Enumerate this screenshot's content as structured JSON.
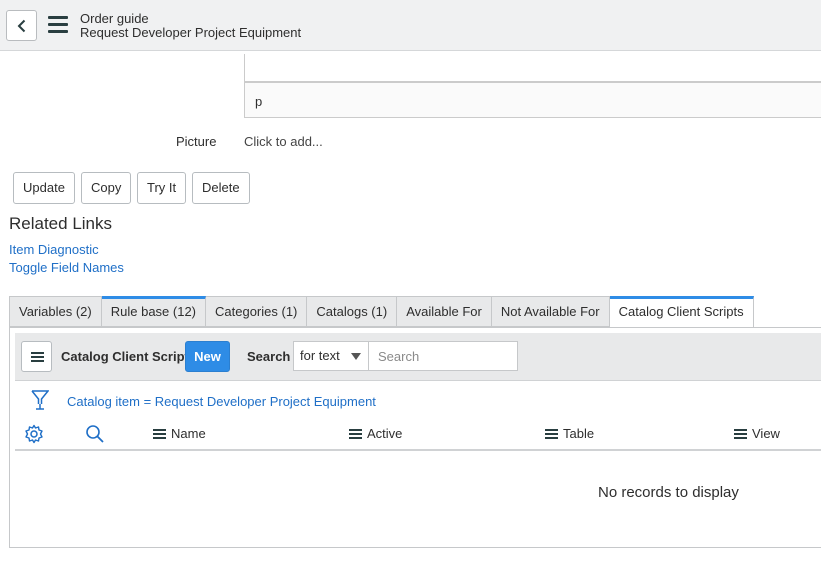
{
  "header": {
    "title": "Order guide",
    "subtitle": "Request Developer Project Equipment"
  },
  "form": {
    "field_value": "p",
    "picture_label": "Picture",
    "picture_value": "Click to add..."
  },
  "actions": {
    "update": "Update",
    "copy": "Copy",
    "try_it": "Try It",
    "delete": "Delete"
  },
  "related_links": {
    "title": "Related Links",
    "items": [
      "Item Diagnostic",
      "Toggle Field Names"
    ]
  },
  "tabs": [
    {
      "label": "Variables (2)"
    },
    {
      "label": "Rule base (12)"
    },
    {
      "label": "Categories (1)"
    },
    {
      "label": "Catalogs (1)"
    },
    {
      "label": "Available For"
    },
    {
      "label": "Not Available For"
    },
    {
      "label": "Catalog Client Scripts"
    }
  ],
  "list": {
    "title": "Catalog Client Scripts",
    "new_label": "New",
    "search_label": "Search",
    "search_field": "for text",
    "search_placeholder": "Search",
    "filter": "Catalog item = Request Developer Project Equipment",
    "columns": [
      "Name",
      "Active",
      "Table",
      "View"
    ],
    "empty_message": "No records to display"
  },
  "colors": {
    "accent": "#2e8ce6",
    "link": "#1f6fc7",
    "header_bg": "#f0f1f2"
  },
  "icons": {
    "back": "chevron-left-icon",
    "menu": "hamburger-icon",
    "filter": "funnel-icon",
    "personalize": "gear-icon",
    "search": "magnifier-icon"
  }
}
